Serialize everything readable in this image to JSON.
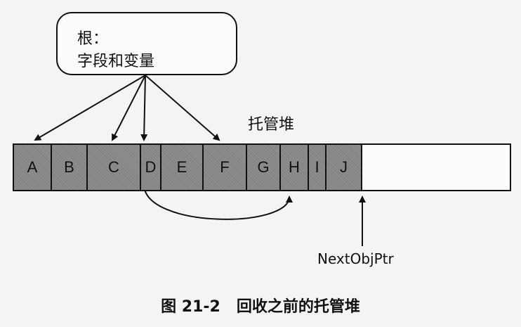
{
  "roots": {
    "title": "根：",
    "subtitle": "字段和变量"
  },
  "heap": {
    "label": "托管堆",
    "objects": [
      "A",
      "B",
      "C",
      "D",
      "E",
      "F",
      "G",
      "H",
      "I",
      "J"
    ]
  },
  "pointer": {
    "label": "NextObjPtr"
  },
  "caption": "图 21-2   回收之前的托管堆"
}
